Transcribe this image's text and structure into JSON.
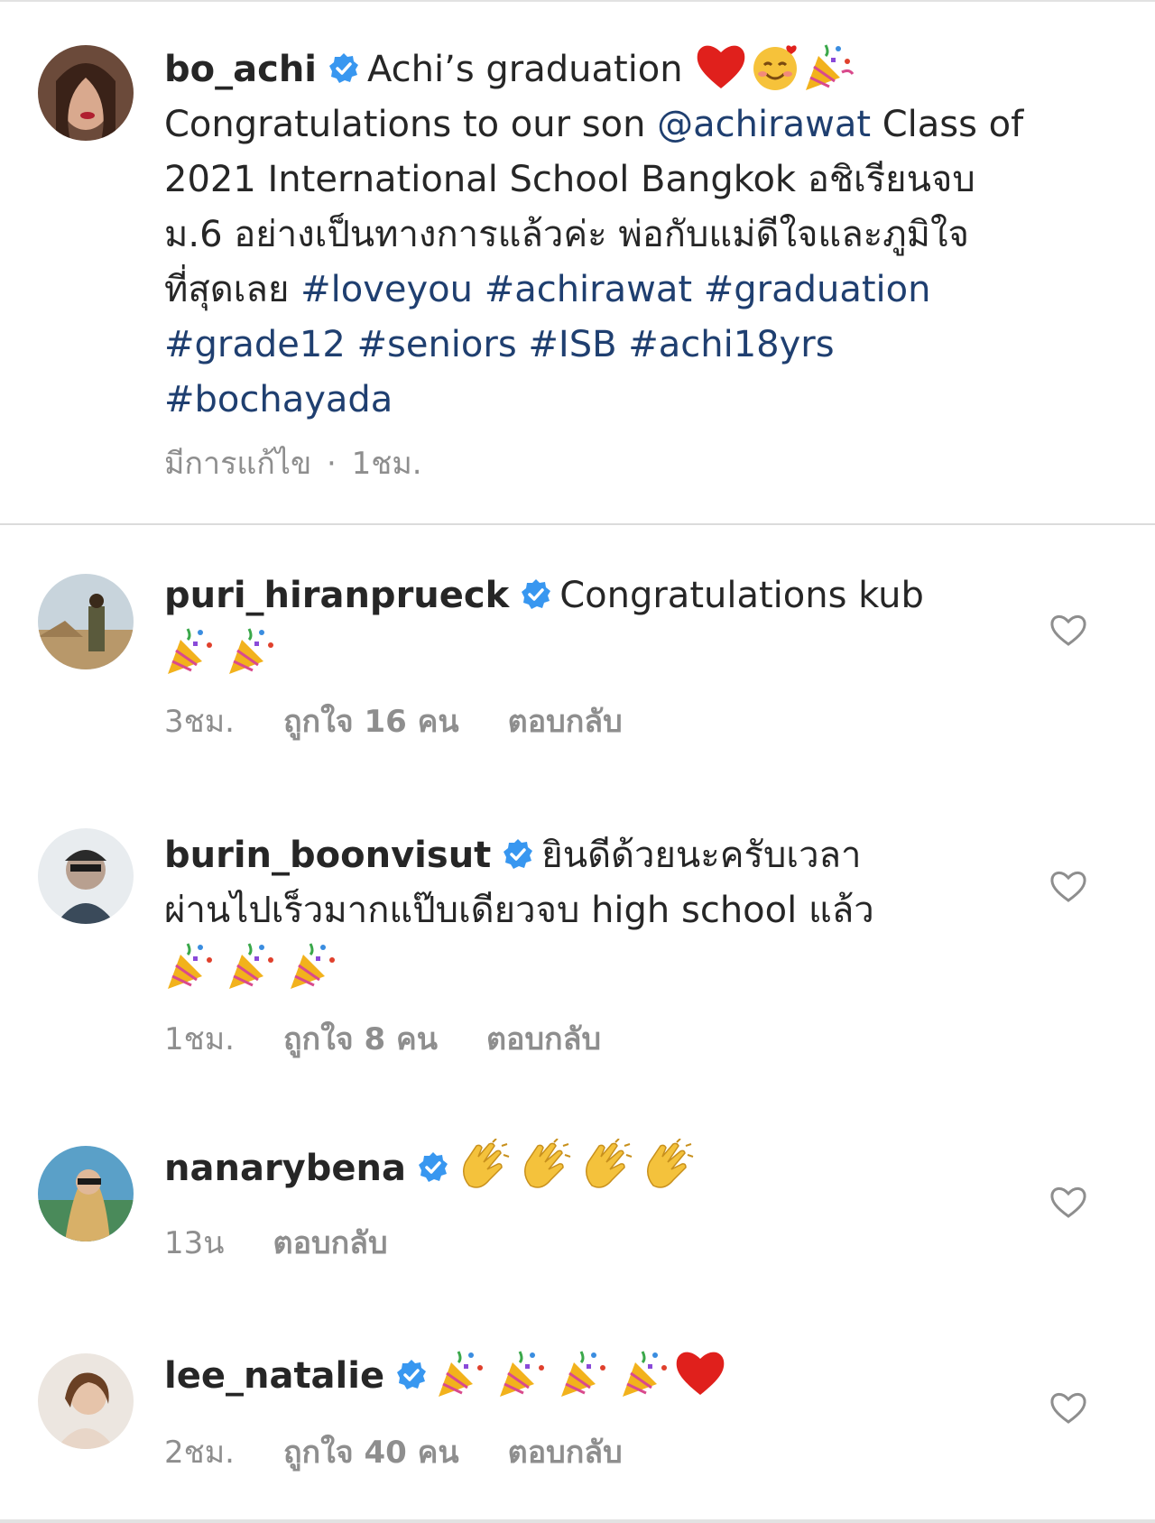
{
  "post": {
    "username": "bo_achi",
    "caption_title": "Achi’s graduation",
    "caption_lines": [
      {
        "pre": "Congratulations to our son ",
        "mention": "@achirawat",
        "post": " Class of"
      },
      {
        "text": "2021 International School Bangkok อชิเรียนจบ"
      },
      {
        "text": "ม.6 อย่างเป็นทางการแล้วค่ะ พ่อกับแม่ดีใจและภูมิใจ"
      },
      {
        "pre": "ที่สุดเลย ",
        "tags": "#loveyou #achirawat #graduation"
      },
      {
        "tags": "#grade12 #seniors #ISB #achi18yrs"
      },
      {
        "tags": "#bochayada"
      }
    ],
    "edited_label": "มีการแก้ไข",
    "separator": "·",
    "time": "1ชม."
  },
  "comments": [
    {
      "username": "puri_hiranprueck",
      "text": "Congratulations kub",
      "time": "3ชม.",
      "likes": "ถูกใจ 16 คน",
      "reply": "ตอบกลับ",
      "emojis": [
        "party-popper",
        "party-popper"
      ]
    },
    {
      "username": "burin_boonvisut",
      "text": "ยินดีด้วยนะครับเวลา",
      "text2": "ผ่านไปเร็วมากแป๊บเดียวจบ high school แล้ว",
      "time": "1ชม.",
      "likes": "ถูกใจ 8 คน",
      "reply": "ตอบกลับ",
      "emojis": [
        "party-popper",
        "party-popper",
        "party-popper"
      ]
    },
    {
      "username": "nanarybena",
      "text": "",
      "time": "13น",
      "likes": "",
      "reply": "ตอบกลับ",
      "emojis": [
        "clapping-hands",
        "clapping-hands",
        "clapping-hands",
        "clapping-hands"
      ]
    },
    {
      "username": "lee_natalie",
      "text": "",
      "time": "2ชม.",
      "likes": "ถูกใจ 40 คน",
      "reply": "ตอบกลับ",
      "emojis": [
        "party-popper",
        "party-popper",
        "party-popper",
        "party-popper",
        "red-heart"
      ]
    }
  ],
  "icons": {
    "verified": "verified-badge-icon",
    "like": "heart-outline-icon"
  },
  "colors": {
    "link": "#1f3f70",
    "verified": "#3897f0",
    "meta": "#8e8e8e",
    "text": "#262626"
  }
}
